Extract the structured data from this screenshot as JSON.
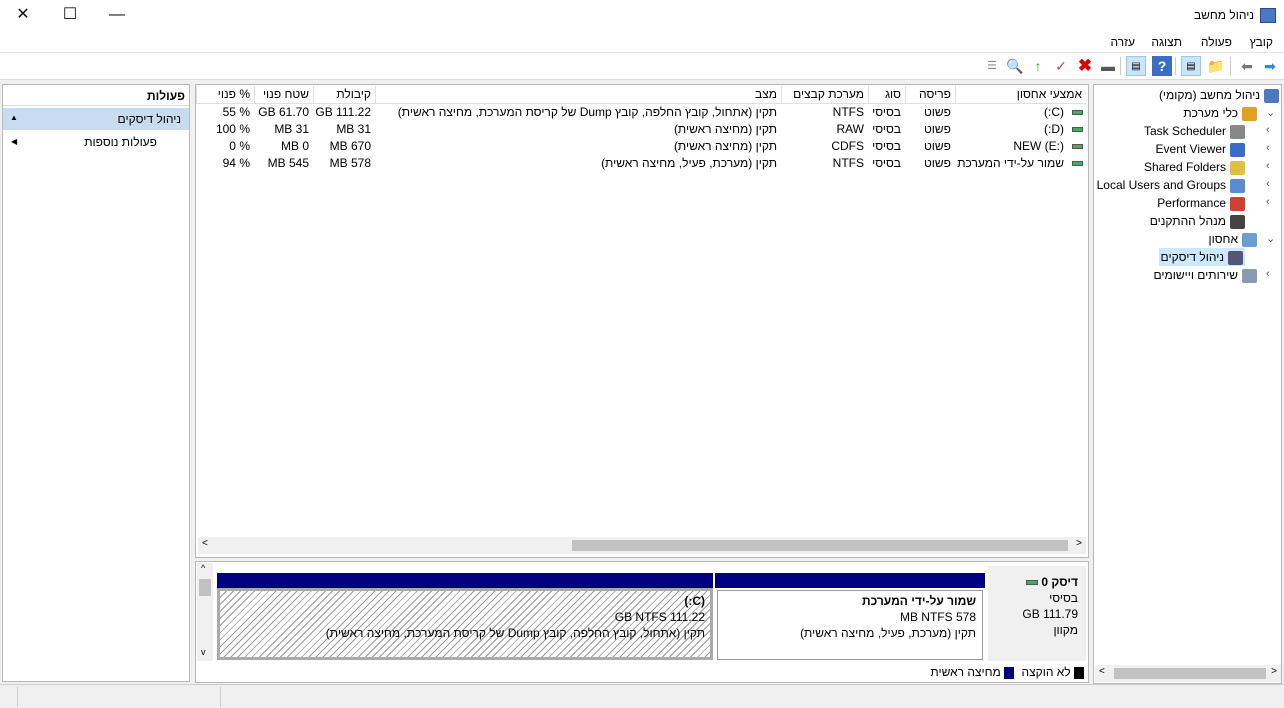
{
  "window": {
    "title": "ניהול מחשב",
    "close": "✕",
    "maximize": "☐",
    "minimize": "—"
  },
  "menu": [
    "קובץ",
    "פעולה",
    "תצוגה",
    "עזרה"
  ],
  "toolbar": {
    "icons": [
      "forward-icon",
      "back-icon",
      "up-folder-icon",
      "show-hide-tree-icon",
      "help-icon",
      "show-hide-action-icon",
      "rescan-icon",
      "delete-icon",
      "check-icon",
      "open-icon",
      "search-icon",
      "properties-icon"
    ]
  },
  "tree": {
    "items": [
      {
        "label": "ניהול מחשב (מקומי)",
        "icon": "computer-management-icon"
      },
      {
        "label": "כלי מערכת",
        "icon": "tools-icon",
        "expanded": true
      },
      {
        "label": "Task Scheduler",
        "icon": "clock-icon"
      },
      {
        "label": "Event Viewer",
        "icon": "event-viewer-icon"
      },
      {
        "label": "Shared Folders",
        "icon": "shared-folder-icon"
      },
      {
        "label": "Local Users and Groups",
        "icon": "users-icon"
      },
      {
        "label": "Performance",
        "icon": "performance-icon"
      },
      {
        "label": "מנהל ההתקנים",
        "icon": "device-manager-icon"
      },
      {
        "label": "אחסון",
        "icon": "storage-icon",
        "expanded": true
      },
      {
        "label": "ניהול דיסקים",
        "icon": "disk-management-icon",
        "selected": true
      },
      {
        "label": "שירותים ויישומים",
        "icon": "services-icon"
      }
    ]
  },
  "table": {
    "headers": [
      "אמצעי אחסון",
      "פריסה",
      "סוג",
      "מערכת קבצים",
      "מצב",
      "קיבולת",
      "שטח פנוי",
      "% פנוי"
    ],
    "rows": [
      [
        "(C:)",
        "פשוט",
        "בסיסי",
        "NTFS",
        "תקין (אתחול, קובץ החלפה, קובץ Dump של קריסת המערכת, מחיצה ראשית)",
        "GB 111.22",
        "GB 61.70",
        "% 55"
      ],
      [
        "(D:)",
        "פשוט",
        "בסיסי",
        "RAW",
        "תקין (מחיצה ראשית)",
        "MB 31",
        "MB 31",
        "% 100"
      ],
      [
        "NEW (E:)",
        "פשוט",
        "בסיסי",
        "CDFS",
        "תקין (מחיצה ראשית)",
        "MB 670",
        "MB 0",
        "% 0"
      ],
      [
        "שמור על-ידי המערכת",
        "פשוט",
        "בסיסי",
        "NTFS",
        "תקין (מערכת, פעיל, מחיצה ראשית)",
        "MB 578",
        "MB 545",
        "% 94"
      ]
    ]
  },
  "disk": {
    "name": "דיסק 0",
    "type": "בסיסי",
    "size": "GB 111.79",
    "status": "מקוון",
    "partitions": [
      {
        "title": "שמור על-ידי המערכת",
        "size": "MB NTFS 578",
        "status": "תקין (מערכת, פעיל, מחיצה ראשית)"
      },
      {
        "title": "(C:)",
        "size": "GB NTFS 111.22",
        "status": "תקין (אתחול, קובץ החלפה, קובץ Dump של קריסת המערכת, מחיצה ראשית)"
      }
    ]
  },
  "legend": [
    {
      "label": "לא הוקצה",
      "color": "#000000"
    },
    {
      "label": "מחיצה ראשית",
      "color": "#000080"
    }
  ],
  "actions": {
    "header": "פעולות",
    "section": "ניהול דיסקים",
    "more": "פעולות נוספות"
  }
}
